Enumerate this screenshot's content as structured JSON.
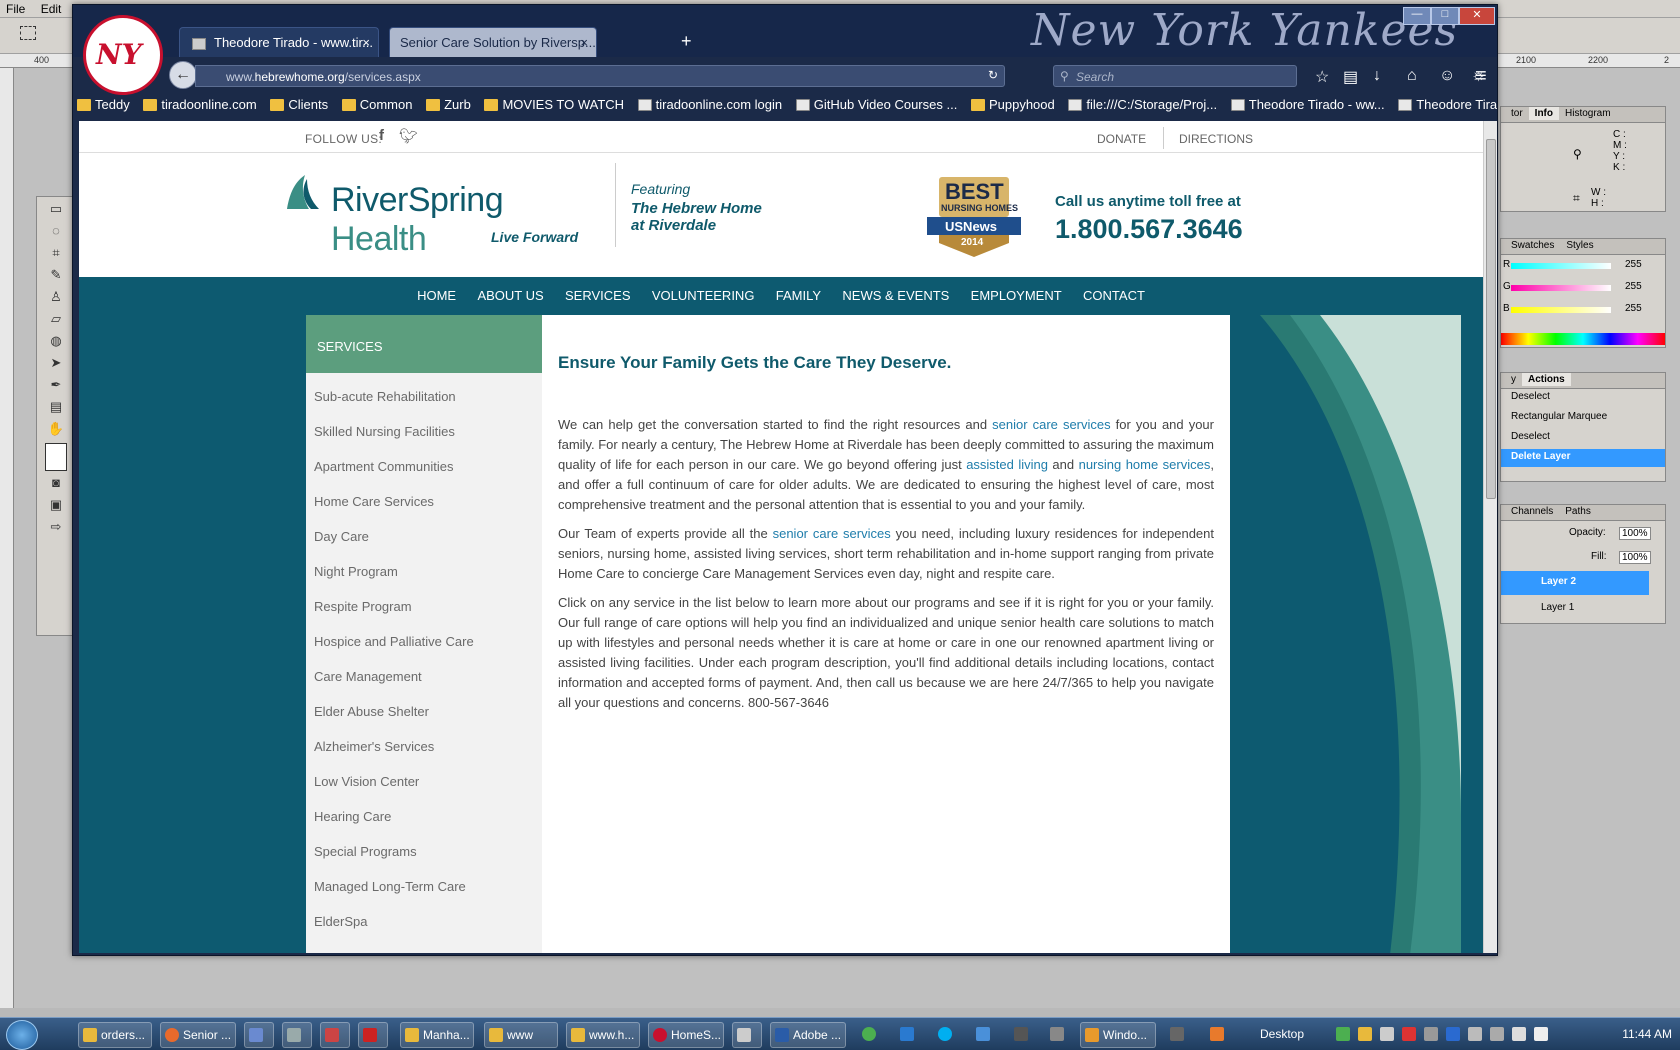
{
  "photoshop": {
    "menu": [
      "File",
      "Edit"
    ],
    "ruler_ticks": [
      "400",
      "2100",
      "2200",
      "2"
    ],
    "panels": {
      "info": {
        "tabs": [
          "tor",
          "Info",
          "Histogram"
        ],
        "cmyk": [
          "C :",
          "M :",
          "Y :",
          "K :"
        ],
        "wh": [
          "W :",
          "H :"
        ]
      },
      "swatches": {
        "tabs": [
          "Swatches",
          "Styles"
        ],
        "values": [
          "255",
          "255",
          "255"
        ],
        "labels": [
          "R",
          "G",
          "B"
        ]
      },
      "actions": {
        "tabs": [
          "y",
          "Actions"
        ],
        "items": [
          "Deselect",
          "Rectangular Marquee",
          "Deselect",
          "Delete Layer"
        ]
      },
      "layers": {
        "tabs": [
          "Channels",
          "Paths"
        ],
        "opacity_label": "Opacity:",
        "opacity": "100%",
        "fill_label": "Fill:",
        "fill": "100%",
        "layers": [
          "Layer 2",
          "Layer 1"
        ]
      }
    }
  },
  "browser": {
    "theme_title": "New York Yankees",
    "theme_logo": "NY",
    "tabs": [
      {
        "label": "Theodore Tirado - www.tir...",
        "active": false
      },
      {
        "label": "Senior Care Solution by Riversp...",
        "active": true
      }
    ],
    "url_prefix": "www.",
    "url_domain": "hebrewhome.org",
    "url_path": "/services.aspx",
    "search_placeholder": "Search",
    "bookmarks": [
      "Teddy",
      "tiradoonline.com",
      "Clients",
      "Common",
      "Zurb",
      "MOVIES TO WATCH",
      "tiradoonline.com login",
      "GitHub Video Courses ...",
      "Puppyhood",
      "file:///C:/Storage/Proj...",
      "Theodore Tirado - ww...",
      "Theodore Tirado - ww..."
    ]
  },
  "site": {
    "follow_us": "FOLLOW US:",
    "donate": "DONATE",
    "directions": "DIRECTIONS",
    "logo_main": "RiverSpring",
    "logo_health": "Health",
    "logo_tagline": "Live Forward",
    "featuring": "Featuring",
    "featuring_name_1": "The Hebrew Home",
    "featuring_name_2": "at Riverdale",
    "badge_best": "BEST",
    "badge_nursing": "NURSING HOMES",
    "badge_usnews": "USNews",
    "badge_year": "2014",
    "call_line": "Call us anytime toll free at",
    "phone": "1.800.567.3646",
    "nav": [
      "HOME",
      "ABOUT US",
      "SERVICES",
      "VOLUNTEERING",
      "FAMILY",
      "NEWS & EVENTS",
      "EMPLOYMENT",
      "CONTACT"
    ],
    "sidebar_header": "SERVICES",
    "sidebar_items": [
      "Sub-acute Rehabilitation",
      "Skilled Nursing Facilities",
      "Apartment Communities",
      "Home Care Services",
      "Day Care",
      "Night Program",
      "Respite Program",
      "Hospice and Palliative Care",
      "Care Management",
      "Elder Abuse Shelter",
      "Alzheimer's Services",
      "Low Vision Center",
      "Hearing Care",
      "Special Programs",
      "Managed Long-Term Care",
      "ElderSpa"
    ],
    "heading": "Ensure Your Family Gets the Care They Deserve.",
    "p1": {
      "a": "We can help get the conversation started to find the right resources and ",
      "link1": "senior care services",
      "b": " for you and your family. For nearly a century, The Hebrew Home at Riverdale has been deeply committed to assuring the maximum quality of life for each person in our care. We go beyond offering just ",
      "link2": "assisted living",
      "c": " and ",
      "link3": "nursing home services",
      "d": ", and offer a full continuum of care for older adults. We are dedicated to ensuring the highest level of care, most comprehensive treatment and the personal attention that is essential to you and your family."
    },
    "p2": {
      "a": "Our Team of experts provide all the ",
      "link1": "senior care services",
      "b": " you need, including luxury residences for independent seniors, nursing home, assisted living services, short term rehabilitation and in-home support ranging from private Home Care to concierge Care Management Services even day, night and respite care."
    },
    "p3": "Click on any service in the list below to learn more about our programs and see if it is right for you or your family. Our full range of care options will help you find an individualized and unique senior health care solutions to match up with lifestyles and personal needs whether it is care at home or care in one our renowned apartment living or assisted living facilities. Under each program description, you'll find additional details including locations, contact information and accepted forms of payment. And, then call us because we are here 24/7/365 to help you navigate all your questions and concerns. 800-567-3646"
  },
  "taskbar": {
    "buttons": [
      "orders...",
      "Senior ...",
      "",
      "",
      "",
      "",
      "Manha...",
      "www",
      "www.h...",
      "HomeS...",
      "",
      "Adobe ...",
      "Windo..."
    ],
    "desktop": "Desktop",
    "time": "11:44 AM"
  },
  "colors": {
    "brand_teal": "#0d5a70",
    "brand_green": "#5c9e7e",
    "link": "#1f7dab",
    "browser_bg": "#1b2a48"
  }
}
